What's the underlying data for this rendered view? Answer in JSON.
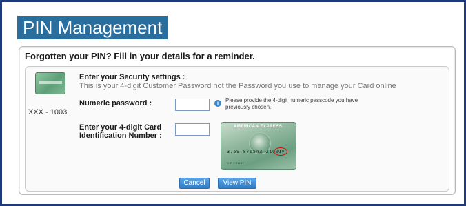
{
  "page": {
    "title": "PIN Management"
  },
  "panel": {
    "heading": "Forgotten your PIN? Fill in your details for a reminder."
  },
  "card_summary": {
    "thumb_icon": "amex-card-thumbnail",
    "number": "XXX - 1003"
  },
  "security": {
    "heading": "Enter your Security settings :",
    "subtext": "This is your 4-digit Customer Password not the Password you use to manage your Card online"
  },
  "form": {
    "numeric_password": {
      "label": "Numeric password :",
      "value": "",
      "hint": "Please provide the 4-digit numeric passcode you have previously chosen."
    },
    "card_id": {
      "label": "Enter your 4-digit Card Identification Number :",
      "value": ""
    }
  },
  "card_image": {
    "brand": "AMERICAN EXPRESS",
    "number": "3759 876543 21001",
    "cid": "1001",
    "name": "C F FROST"
  },
  "buttons": {
    "cancel": "Cancel",
    "view_pin": "View PIN"
  },
  "colors": {
    "frame": "#1f3a7a",
    "title_bg": "#2a6e9e",
    "button": "#2f7bc4"
  }
}
